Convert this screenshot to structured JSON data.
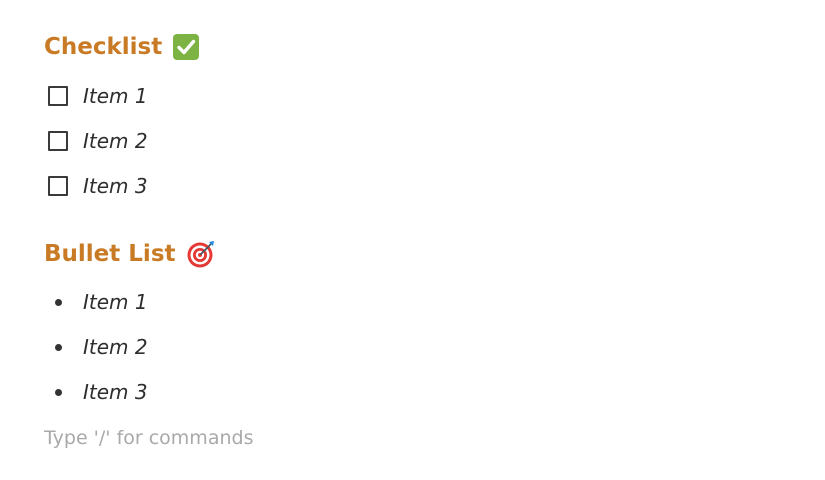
{
  "checklist": {
    "heading": "Checklist",
    "heading_icon": "check-mark-button-emoji",
    "items": [
      {
        "label": "Item 1",
        "checked": false
      },
      {
        "label": "Item 2",
        "checked": false
      },
      {
        "label": "Item 3",
        "checked": false
      }
    ]
  },
  "bullet_list": {
    "heading": "Bullet List",
    "heading_icon": "direct-hit-target-emoji",
    "items": [
      {
        "label": "Item 1"
      },
      {
        "label": "Item 2"
      },
      {
        "label": "Item 3"
      }
    ]
  },
  "editor": {
    "placeholder": "Type '/' for commands"
  },
  "colors": {
    "heading": "#c97a24",
    "text": "#2e2e2e",
    "placeholder": "#a9a9a9",
    "check_emoji_bg": "#7cb342"
  }
}
